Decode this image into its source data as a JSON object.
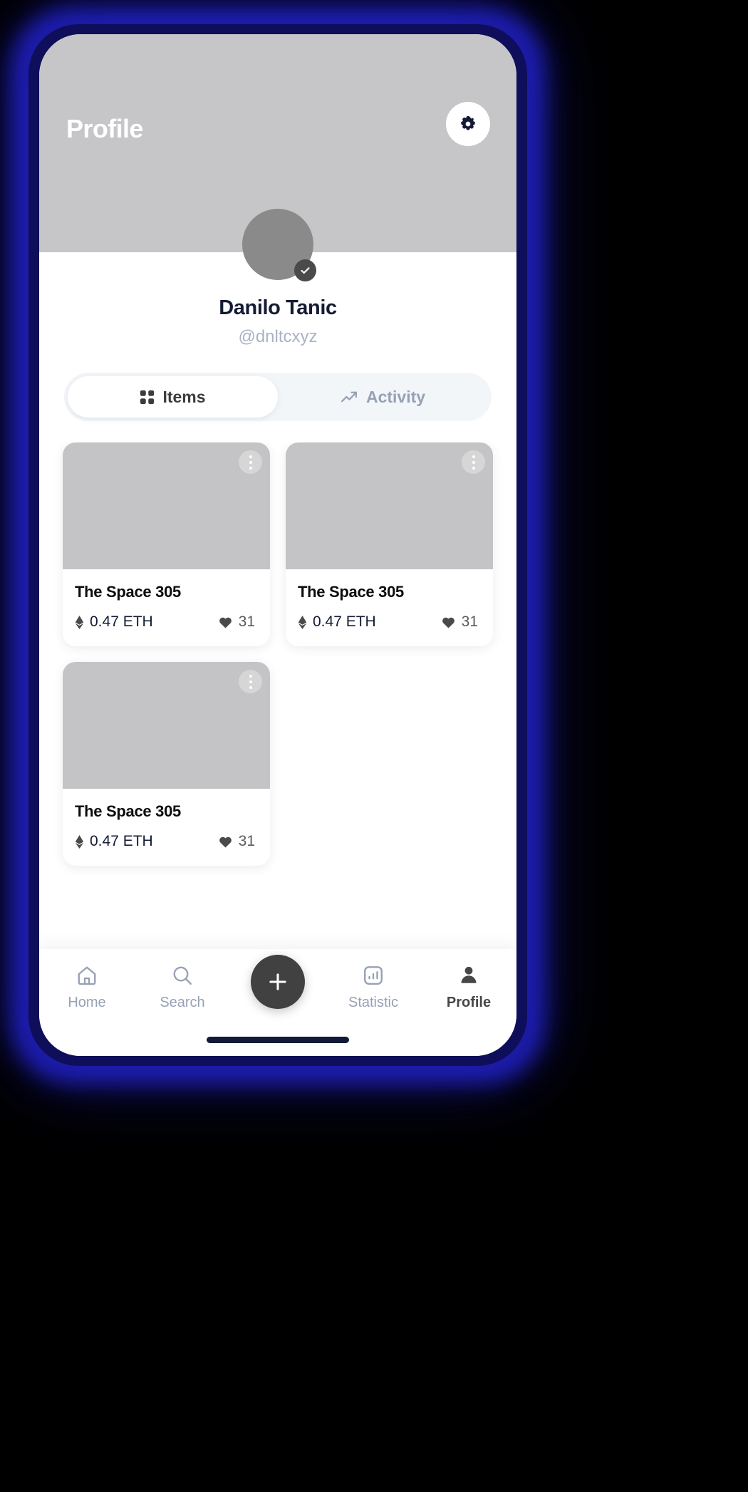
{
  "header": {
    "title": "Profile",
    "settings_icon": "gear-icon"
  },
  "profile": {
    "avatar_icon": "avatar",
    "verified_icon": "check-icon",
    "display_name": "Danilo Tanic",
    "handle": "@dnltcxyz"
  },
  "tabs": [
    {
      "label": "Items",
      "icon": "grid-icon",
      "active": true
    },
    {
      "label": "Activity",
      "icon": "trending-up-icon",
      "active": false
    }
  ],
  "items": [
    {
      "title": "The Space 305",
      "price": "0.47 ETH",
      "price_icon": "ethereum-icon",
      "likes": "31",
      "likes_icon": "heart-icon",
      "menu_icon": "more-vertical-icon"
    },
    {
      "title": "The Space 305",
      "price": "0.47 ETH",
      "price_icon": "ethereum-icon",
      "likes": "31",
      "likes_icon": "heart-icon",
      "menu_icon": "more-vertical-icon"
    },
    {
      "title": "The Space 305",
      "price": "0.47 ETH",
      "price_icon": "ethereum-icon",
      "likes": "31",
      "likes_icon": "heart-icon",
      "menu_icon": "more-vertical-icon"
    }
  ],
  "bottom_nav": {
    "items": [
      {
        "label": "Home",
        "icon": "home-icon",
        "active": false
      },
      {
        "label": "Search",
        "icon": "search-icon",
        "active": false
      },
      {
        "label": "Statistic",
        "icon": "statistic-icon",
        "active": false
      },
      {
        "label": "Profile",
        "icon": "person-icon",
        "active": true
      }
    ],
    "fab_icon": "plus-icon"
  },
  "colors": {
    "accent_navy": "#141b34",
    "muted_blue": "#97a1b5",
    "placeholder_gray": "#c4c4c6",
    "fab_dark": "#414141",
    "glow_blue": "#1a1a9e"
  }
}
